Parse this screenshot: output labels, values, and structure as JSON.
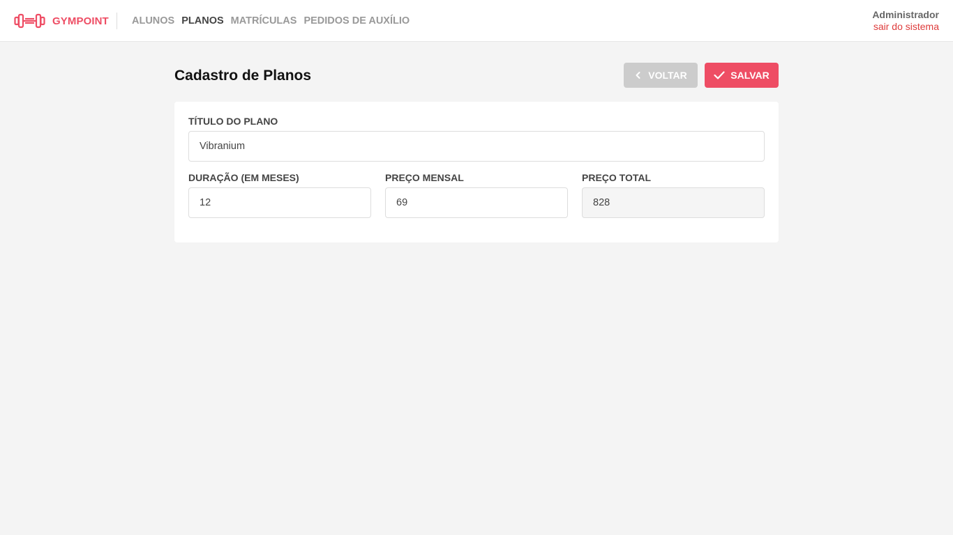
{
  "app": {
    "brand": "GYMPOINT",
    "brand_color": "#ee4d64"
  },
  "nav": {
    "items": [
      {
        "label": "ALUNOS",
        "active": false
      },
      {
        "label": "PLANOS",
        "active": true
      },
      {
        "label": "MATRÍCULAS",
        "active": false
      },
      {
        "label": "PEDIDOS DE AUXÍLIO",
        "active": false
      }
    ]
  },
  "user": {
    "name": "Administrador",
    "logout": "sair do sistema"
  },
  "page": {
    "title": "Cadastro de Planos"
  },
  "actions": {
    "back_label": "VOLTAR",
    "back_icon": "chevron-left-icon",
    "save_label": "SALVAR",
    "save_icon": "check-icon"
  },
  "form": {
    "title": {
      "label": "TÍTULO DO PLANO",
      "value": "Vibranium"
    },
    "duration": {
      "label": "DURAÇÃO (EM MESES)",
      "value": "12"
    },
    "monthly_price": {
      "label": "PREÇO MENSAL",
      "value": "69"
    },
    "total_price": {
      "label": "PREÇO TOTAL",
      "value": "828",
      "readonly": true
    }
  }
}
